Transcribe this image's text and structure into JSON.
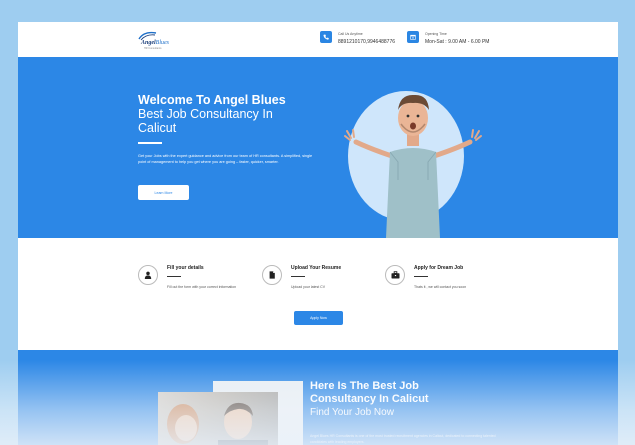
{
  "header": {
    "logo": {
      "brand_main": "Angel",
      "brand_accent": "Blues",
      "tagline": "HR Consultants"
    },
    "call": {
      "label": "Call Us Anytime",
      "value": "8891210170,9946488776"
    },
    "hours": {
      "label": "Opening Time",
      "value": "Mon-Sat : 9.00 AM - 6.00 PM"
    }
  },
  "hero": {
    "title_line1": "Welcome To Angel Blues",
    "title_line2": "Best Job Consultancy In",
    "title_line3": "Calicut",
    "description": "Get your Jobs with the expert guidance and advice from our team of HR consultants. A simplified, single point of management to help you get where you are going – faster, quicker, smarter.",
    "button": "Learn More"
  },
  "steps": [
    {
      "title": "Fill your details",
      "text": "Fill out the form with your correct information",
      "icon": "user-icon"
    },
    {
      "title": "Upload Your Resume",
      "text": "Upload your latest CV",
      "icon": "document-icon"
    },
    {
      "title": "Apply for Dream Job",
      "text": "Thats it , we will contact you soon",
      "icon": "briefcase-icon"
    }
  ],
  "apply_button": "Apply Now",
  "about": {
    "title_line1": "Here Is The Best Job",
    "title_line2": "Consultancy In Calicut",
    "title_line3": "Find Your Job Now",
    "text": "Angel Blues HR Consultants is one of the most trusted recruitment agencies in Calicut, dedicated to connecting talented candidates with leading employers."
  },
  "colors": {
    "primary": "#2c87e6",
    "background": "#9ecdf0",
    "circle": "#cfe6fb"
  }
}
